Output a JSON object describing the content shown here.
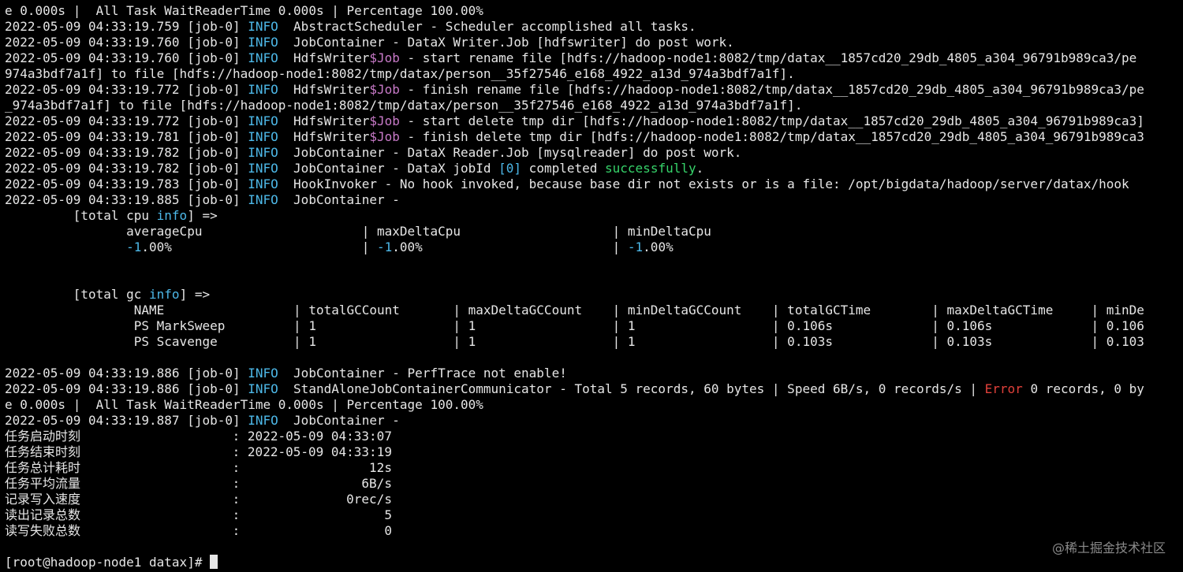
{
  "colors": {
    "background": "#000000",
    "text": "#e6e6e6",
    "info": "#4db8e8",
    "dollar": "#c87ac8",
    "number": "#4db8e8",
    "success": "#36d36a",
    "error": "#e0403a",
    "watermark": "#8a8a8a"
  },
  "terminal": {
    "lines": [
      [
        {
          "t": "e 0.000s |  All Task WaitReaderTime 0.000s | Percentage 100.00%"
        }
      ],
      [
        {
          "t": "2022-05-09 04:33:19.759 [job-0] "
        },
        {
          "t": "INFO",
          "c": "info"
        },
        {
          "t": "  AbstractScheduler - Scheduler accomplished all tasks."
        }
      ],
      [
        {
          "t": "2022-05-09 04:33:19.760 [job-0] "
        },
        {
          "t": "INFO",
          "c": "info"
        },
        {
          "t": "  JobContainer - DataX Writer.Job [hdfswriter] do post work."
        }
      ],
      [
        {
          "t": "2022-05-09 04:33:19.760 [job-0] "
        },
        {
          "t": "INFO",
          "c": "info"
        },
        {
          "t": "  HdfsWriter"
        },
        {
          "t": "$Job",
          "c": "dollar"
        },
        {
          "t": " - start rename file [hdfs://hadoop-node1:8082/tmp/datax__1857cd20_29db_4805_a304_96791b989ca3/pe"
        }
      ],
      [
        {
          "t": "974a3bdf7a1f] to file [hdfs://hadoop-node1:8082/tmp/datax/person__35f27546_e168_4922_a13d_974a3bdf7a1f]."
        }
      ],
      [
        {
          "t": "2022-05-09 04:33:19.772 [job-0] "
        },
        {
          "t": "INFO",
          "c": "info"
        },
        {
          "t": "  HdfsWriter"
        },
        {
          "t": "$Job",
          "c": "dollar"
        },
        {
          "t": " - finish rename file [hdfs://hadoop-node1:8082/tmp/datax__1857cd20_29db_4805_a304_96791b989ca3/pe"
        }
      ],
      [
        {
          "t": "_974a3bdf7a1f] to file [hdfs://hadoop-node1:8082/tmp/datax/person__35f27546_e168_4922_a13d_974a3bdf7a1f]."
        }
      ],
      [
        {
          "t": "2022-05-09 04:33:19.772 [job-0] "
        },
        {
          "t": "INFO",
          "c": "info"
        },
        {
          "t": "  HdfsWriter"
        },
        {
          "t": "$Job",
          "c": "dollar"
        },
        {
          "t": " - start delete tmp dir [hdfs://hadoop-node1:8082/tmp/datax__1857cd20_29db_4805_a304_96791b989ca3]"
        }
      ],
      [
        {
          "t": "2022-05-09 04:33:19.781 [job-0] "
        },
        {
          "t": "INFO",
          "c": "info"
        },
        {
          "t": "  HdfsWriter"
        },
        {
          "t": "$Job",
          "c": "dollar"
        },
        {
          "t": " - finish delete tmp dir [hdfs://hadoop-node1:8082/tmp/datax__1857cd20_29db_4805_a304_96791b989ca3"
        }
      ],
      [
        {
          "t": "2022-05-09 04:33:19.782 [job-0] "
        },
        {
          "t": "INFO",
          "c": "info"
        },
        {
          "t": "  JobContainer - DataX Reader.Job [mysqlreader] do post work."
        }
      ],
      [
        {
          "t": "2022-05-09 04:33:19.782 [job-0] "
        },
        {
          "t": "INFO",
          "c": "info"
        },
        {
          "t": "  JobContainer - DataX jobId "
        },
        {
          "t": "[0]",
          "c": "num"
        },
        {
          "t": " completed "
        },
        {
          "t": "successfully",
          "c": "success"
        },
        {
          "t": "."
        }
      ],
      [
        {
          "t": "2022-05-09 04:33:19.783 [job-0] "
        },
        {
          "t": "INFO",
          "c": "info"
        },
        {
          "t": "  HookInvoker - No hook invoked, because base dir not exists or is a file: /opt/bigdata/hadoop/server/datax/hook"
        }
      ],
      [
        {
          "t": "2022-05-09 04:33:19.885 [job-0] "
        },
        {
          "t": "INFO",
          "c": "info"
        },
        {
          "t": "  JobContainer -"
        }
      ],
      [
        {
          "t": "         [total cpu "
        },
        {
          "t": "info",
          "c": "info"
        },
        {
          "t": "] =>"
        }
      ],
      [
        {
          "t": "                averageCpu                     | maxDeltaCpu                    | minDeltaCpu"
        }
      ],
      [
        {
          "t": "                "
        },
        {
          "t": "-1",
          "c": "num"
        },
        {
          "t": ".00%                         | "
        },
        {
          "t": "-1",
          "c": "num"
        },
        {
          "t": ".00%                         | "
        },
        {
          "t": "-1",
          "c": "num"
        },
        {
          "t": ".00%"
        }
      ],
      [
        {
          "t": ""
        }
      ],
      [
        {
          "t": ""
        }
      ],
      [
        {
          "t": "         [total gc "
        },
        {
          "t": "info",
          "c": "info"
        },
        {
          "t": "] =>"
        }
      ],
      [
        {
          "t": "                 NAME                 | totalGCCount       | maxDeltaGCCount    | minDeltaGCCount    | totalGCTime        | maxDeltaGCTime     | minDe"
        }
      ],
      [
        {
          "t": "                 PS MarkSweep         | 1                  | 1                  | 1                  | 0.106s             | 0.106s             | 0.106"
        }
      ],
      [
        {
          "t": "                 PS Scavenge          | 1                  | 1                  | 1                  | 0.103s             | 0.103s             | 0.103"
        }
      ],
      [
        {
          "t": ""
        }
      ],
      [
        {
          "t": "2022-05-09 04:33:19.886 [job-0] "
        },
        {
          "t": "INFO",
          "c": "info"
        },
        {
          "t": "  JobContainer - PerfTrace not enable!"
        }
      ],
      [
        {
          "t": "2022-05-09 04:33:19.886 [job-0] "
        },
        {
          "t": "INFO",
          "c": "info"
        },
        {
          "t": "  StandAloneJobContainerCommunicator - Total 5 records, 60 bytes | Speed 6B/s, 0 records/s | "
        },
        {
          "t": "Error",
          "c": "error"
        },
        {
          "t": " 0 records, 0 by"
        }
      ],
      [
        {
          "t": "e 0.000s |  All Task WaitReaderTime 0.000s | Percentage 100.00%"
        }
      ],
      [
        {
          "t": "2022-05-09 04:33:19.887 [job-0] "
        },
        {
          "t": "INFO",
          "c": "info"
        },
        {
          "t": "  JobContainer -"
        }
      ],
      [
        {
          "t": "任务启动时刻                    : 2022-05-09 04:33:07"
        }
      ],
      [
        {
          "t": "任务结束时刻                    : 2022-05-09 04:33:19"
        }
      ],
      [
        {
          "t": "任务总计耗时                    :                 12s"
        }
      ],
      [
        {
          "t": "任务平均流量                    :                6B/s"
        }
      ],
      [
        {
          "t": "记录写入速度                    :              0rec/s"
        }
      ],
      [
        {
          "t": "读出记录总数                    :                   5"
        }
      ],
      [
        {
          "t": "读写失败总数                    :                   0"
        }
      ],
      [
        {
          "t": ""
        }
      ]
    ],
    "prompt": "[root@hadoop-node1 datax]# "
  },
  "watermark": "@稀土掘金技术社区"
}
